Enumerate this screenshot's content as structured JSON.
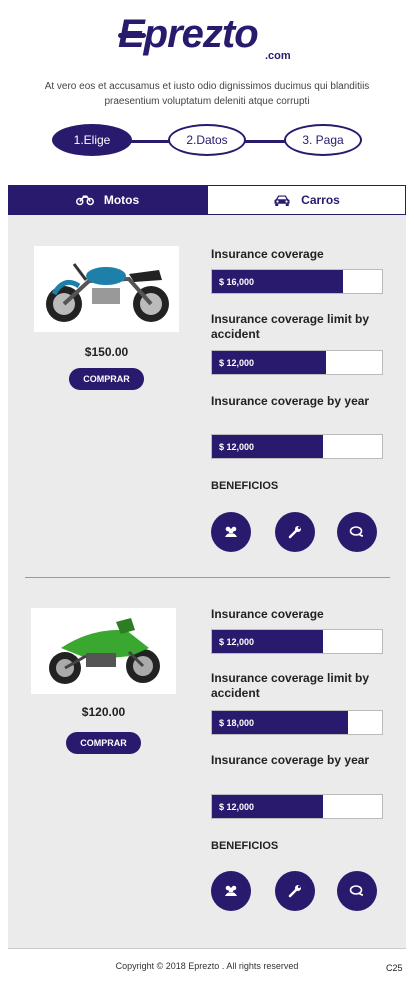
{
  "brand": {
    "name": "Eprezto",
    "suffix": ".com"
  },
  "intro": "At vero eos et accusamus et iusto odio dignissimos ducimus qui blanditiis praesentium voluptatum deleniti atque corrupti",
  "steps": [
    {
      "label": "1.Elige",
      "active": true
    },
    {
      "label": "2.Datos",
      "active": false
    },
    {
      "label": "3. Paga",
      "active": false
    }
  ],
  "tabs": [
    {
      "label": "Motos",
      "icon": "motorcycle-icon",
      "active": true
    },
    {
      "label": "Carros",
      "icon": "car-icon",
      "active": false
    }
  ],
  "colors": {
    "primary": "#2a1a6e",
    "panel": "#ebebeb"
  },
  "products": [
    {
      "price": "$150.00",
      "button": "COMPRAR",
      "bike_color": "#1e7fa8",
      "coverages": [
        {
          "title": "Insurance coverage",
          "value": "$ 16,000",
          "fill": 0.77
        },
        {
          "title": "Insurance coverage limit by accident",
          "value": "$ 12,000",
          "fill": 0.67
        },
        {
          "title": "Insurance coverage by year",
          "value": "$ 12,000",
          "fill": 0.65
        }
      ],
      "benefits_title": "BENEFICIOS",
      "benefits": [
        "group-icon",
        "wrench-icon",
        "chat-icon"
      ]
    },
    {
      "price": "$120.00",
      "button": "COMPRAR",
      "bike_color": "#3aa830",
      "coverages": [
        {
          "title": "Insurance coverage",
          "value": "$ 12,000",
          "fill": 0.65
        },
        {
          "title": "Insurance coverage limit by accident",
          "value": "$ 18,000",
          "fill": 0.8
        },
        {
          "title": "Insurance coverage by year",
          "value": "$ 12,000",
          "fill": 0.65
        }
      ],
      "benefits_title": "BENEFICIOS",
      "benefits": [
        "group-icon",
        "wrench-icon",
        "chat-icon"
      ]
    }
  ],
  "footer": {
    "copyright": "Copyright © 2018 Eprezto . All rights reserved",
    "badge": "C25"
  }
}
